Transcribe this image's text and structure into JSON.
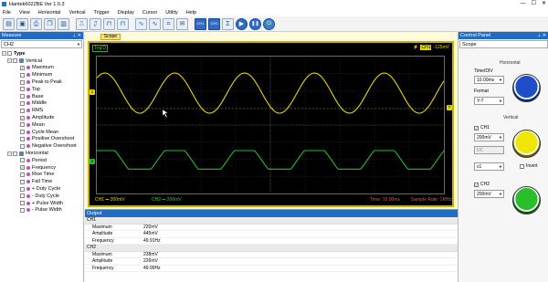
{
  "window": {
    "title": "Hantek6022BE Ver 1.0.3",
    "minimize": "—",
    "maximize": "☐",
    "close": "✕"
  },
  "menu": [
    "File",
    "View",
    "Horizontal",
    "Vertical",
    "Trigger",
    "Display",
    "Cursor",
    "Utility",
    "Help"
  ],
  "toolbar": {
    "buttons": [
      "open-icon",
      "save-icon",
      "print-icon",
      "copy-icon",
      "paste-icon",
      "rise-edge-icon",
      "fall-edge-icon",
      "pulse-icon",
      "wave1-icon",
      "wave2-icon",
      "wave3-icon",
      "measure-icon",
      "mail-icon",
      "ch1-icon",
      "ch2-icon",
      "math-icon",
      "run-icon",
      "pause-icon",
      "stop-icon"
    ],
    "ch1_label": "CH1",
    "ch2_label": "CH2"
  },
  "measure": {
    "header": "Measure",
    "channel": "CH2",
    "type_label": "Type",
    "vertical_label": "Vertical",
    "vertical_items": [
      {
        "label": "Maximum",
        "checked": true
      },
      {
        "label": "Minimum",
        "checked": false
      },
      {
        "label": "Peak to Peak",
        "checked": false
      },
      {
        "label": "Top",
        "checked": false
      },
      {
        "label": "Base",
        "checked": false
      },
      {
        "label": "Middle",
        "checked": false
      },
      {
        "label": "RMS",
        "checked": false
      },
      {
        "label": "Amplitude",
        "checked": true
      },
      {
        "label": "Mean",
        "checked": false
      },
      {
        "label": "Cycle Mean",
        "checked": false
      },
      {
        "label": "Positive Overshoot",
        "checked": false
      },
      {
        "label": "Negative Overshoot",
        "checked": false
      }
    ],
    "horizontal_label": "Horizontal",
    "horizontal_items": [
      {
        "label": "Period",
        "checked": false
      },
      {
        "label": "Frequency",
        "checked": true
      },
      {
        "label": "Rise Time",
        "checked": false
      },
      {
        "label": "Fall Time",
        "checked": false
      },
      {
        "label": "+ Duty Cycle",
        "checked": false
      },
      {
        "label": "- Duty Cycle",
        "checked": false
      },
      {
        "label": "+ Pulse Width",
        "checked": false
      },
      {
        "label": "- Pulse Width",
        "checked": false
      }
    ]
  },
  "scope": {
    "tab": "Scope",
    "trig_status": "Trig'D",
    "trig_channel": "CH1",
    "trig_level": "-125mV",
    "ch1_status": "CH1 ⎓ 200mV",
    "ch2_status": "CH2 ⎓ 200mV",
    "time_status": "Time: 10.00ms",
    "sample_rate": "Sample Rate: 1MHz",
    "ch1_marker": "1",
    "ch2_marker": "2",
    "trig_marker": "T",
    "ch1_color": "#e8d600",
    "ch2_color": "#22c02a"
  },
  "output": {
    "header": "Output",
    "groups": [
      {
        "channel": "CH1",
        "rows": [
          [
            "Maximum",
            "220mV"
          ],
          [
            "Amplitude",
            "445mV"
          ],
          [
            "Frequency",
            "49.91Hz"
          ]
        ]
      },
      {
        "channel": "CH2",
        "rows": [
          [
            "Maximum",
            "238mV"
          ],
          [
            "Amplitude",
            "226mV"
          ],
          [
            "Frequency",
            "49.99Hz"
          ]
        ]
      }
    ]
  },
  "control": {
    "header": "Control Panel",
    "mode": "Scope",
    "horizontal_label": "Horizontal",
    "timediv_label": "Time/DIV",
    "timediv_value": "10.00ms",
    "format_label": "Format",
    "format_value": "Y-T",
    "vertical_label": "Vertical",
    "ch1_label": "CH1",
    "ch1_volt": "200mV",
    "ch1_coupling": "DC",
    "ch1_probe": "x1",
    "invert_label": "Invert",
    "ch2_label": "CH2",
    "ch2_volt": "200mV"
  }
}
